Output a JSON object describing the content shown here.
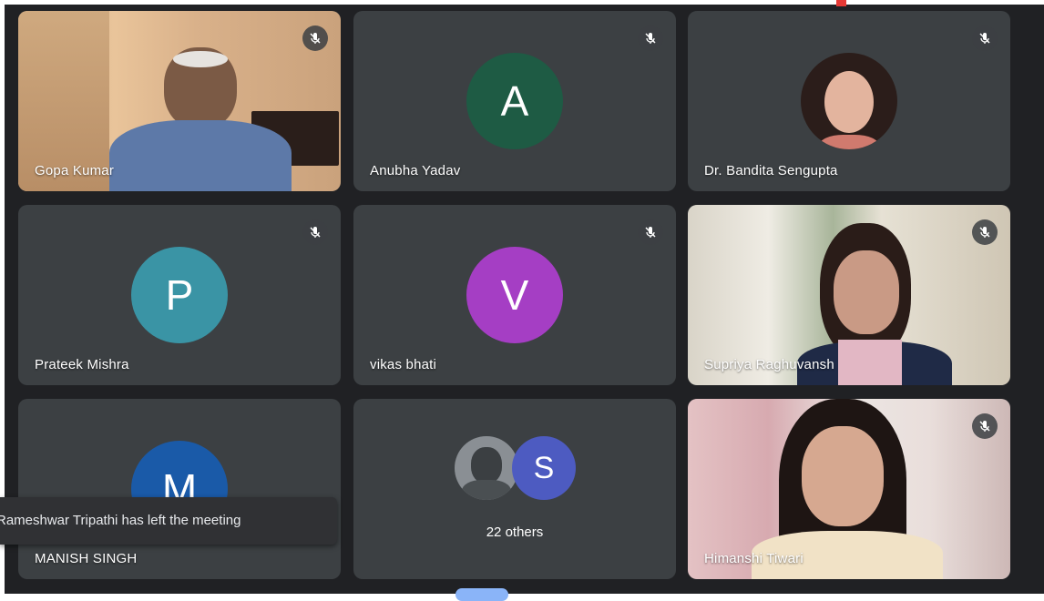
{
  "participants": [
    {
      "name": "Gopa Kumar",
      "type": "video"
    },
    {
      "name": "Anubha Yadav",
      "type": "avatar",
      "initial": "A",
      "color": "#1e5b44"
    },
    {
      "name": "Dr. Bandita Sengupta",
      "type": "photo"
    },
    {
      "name": "Prateek Mishra",
      "type": "avatar",
      "initial": "P",
      "color": "#3a94a5"
    },
    {
      "name": "vikas bhati",
      "type": "avatar",
      "initial": "V",
      "color": "#a53ec4"
    },
    {
      "name": "Supriya Raghuvansh",
      "type": "video"
    },
    {
      "name": "MANISH SINGH",
      "type": "avatar",
      "initial": "M",
      "color": "#1a5aa8"
    },
    {
      "name": "Himanshi Tiwari",
      "type": "video"
    }
  ],
  "others_tile": {
    "label": "22 others",
    "initial": "S",
    "initial_color": "#4d5bc1"
  },
  "notification": {
    "text": "Rameshwar Tripathi has left the meeting"
  },
  "icons": {
    "mute": "mic-off-icon"
  }
}
